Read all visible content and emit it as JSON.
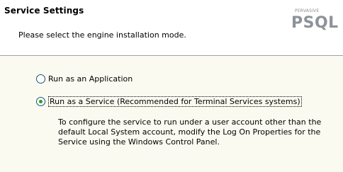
{
  "header": {
    "title": "Service Settings",
    "subtitle": "Please select the engine installation mode.",
    "logo": {
      "brand_small": "PERVASIVE",
      "brand_big": "PSQL"
    }
  },
  "options": [
    {
      "label": "Run as an Application",
      "selected": false
    },
    {
      "label": "Run as a Service (Recommended for Terminal Services systems)",
      "selected": true
    }
  ],
  "description": {
    "lines": [
      "To configure the service to run under a user account other than the",
      "default Local System account, modify the Log On Properties for the",
      "Service using the Windows Control Panel."
    ]
  },
  "colors": {
    "content_bg": "#fbfaf1",
    "radio_dot": "#21a121",
    "logo": "#8d929a"
  }
}
